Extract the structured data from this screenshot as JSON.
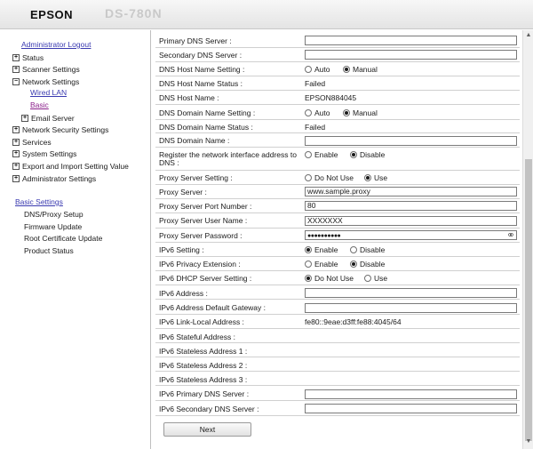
{
  "header": {
    "brand": "EPSON",
    "model": "DS-780N"
  },
  "sidebar": {
    "logout": "Administrator Logout",
    "items": [
      {
        "label": "Status",
        "box": "+"
      },
      {
        "label": "Scanner Settings",
        "box": "+"
      },
      {
        "label": "Network Settings",
        "box": "−"
      },
      {
        "label": "Wired LAN"
      },
      {
        "label": "Basic"
      },
      {
        "label": "Email Server",
        "box": "+"
      },
      {
        "label": "Network Security Settings",
        "box": "+"
      },
      {
        "label": "Services",
        "box": "+"
      },
      {
        "label": "System Settings",
        "box": "+"
      },
      {
        "label": "Export and Import Setting Value",
        "box": "+"
      },
      {
        "label": "Administrator Settings",
        "box": "+"
      }
    ],
    "basic_settings": {
      "title": "Basic Settings",
      "links": [
        "DNS/Proxy Setup",
        "Firmware Update",
        "Root Certificate Update",
        "Product Status"
      ]
    }
  },
  "form": {
    "rows": [
      {
        "label": "Primary DNS Server :",
        "value": ""
      },
      {
        "label": "Secondary DNS Server :",
        "value": ""
      },
      {
        "label": "DNS Host Name Setting :",
        "options": [
          "Auto",
          "Manual"
        ],
        "selected": "Manual"
      },
      {
        "label": "DNS Host Name Status :",
        "value": "Failed"
      },
      {
        "label": "DNS Host Name :",
        "value": "EPSON884045"
      },
      {
        "label": "DNS Domain Name Setting :",
        "options": [
          "Auto",
          "Manual"
        ],
        "selected": "Manual"
      },
      {
        "label": "DNS Domain Name Status :",
        "value": "Failed"
      },
      {
        "label": "DNS Domain Name :",
        "value": ""
      },
      {
        "label": "Register the network interface address to",
        "label2": "DNS :",
        "options": [
          "Enable",
          "Disable"
        ],
        "selected": "Disable"
      },
      {
        "label": "Proxy Server Setting :",
        "options": [
          "Do Not Use",
          "Use"
        ],
        "selected": "Use"
      },
      {
        "label": "Proxy Server :",
        "value": "www.sample.proxy"
      },
      {
        "label": "Proxy Server Port Number :",
        "value": "80"
      },
      {
        "label": "Proxy Server User Name :",
        "value": "XXXXXXX"
      },
      {
        "label": "Proxy Server Password :",
        "value": "●●●●●●●●●●"
      },
      {
        "label": "IPv6 Setting :",
        "options": [
          "Enable",
          "Disable"
        ],
        "selected": "Enable"
      },
      {
        "label": "IPv6 Privacy Extension :",
        "options": [
          "Enable",
          "Disable"
        ],
        "selected": "Disable"
      },
      {
        "label": "IPv6 DHCP Server Setting :",
        "options": [
          "Do Not Use",
          "Use"
        ],
        "selected": "Do Not Use"
      },
      {
        "label": "IPv6 Address :",
        "value": ""
      },
      {
        "label": "IPv6 Address Default Gateway :",
        "value": ""
      },
      {
        "label": "IPv6 Link-Local Address :",
        "value": "fe80::9eae:d3ff:fe88:4045/64"
      },
      {
        "label": "IPv6 Stateful Address :",
        "value": ""
      },
      {
        "label": "IPv6 Stateless Address 1 :",
        "value": ""
      },
      {
        "label": "IPv6 Stateless Address 2 :",
        "value": ""
      },
      {
        "label": "IPv6 Stateless Address 3 :",
        "value": ""
      },
      {
        "label": "IPv6 Primary DNS Server :",
        "value": ""
      },
      {
        "label": "IPv6 Secondary DNS Server :",
        "value": ""
      }
    ],
    "next_label": "Next"
  }
}
